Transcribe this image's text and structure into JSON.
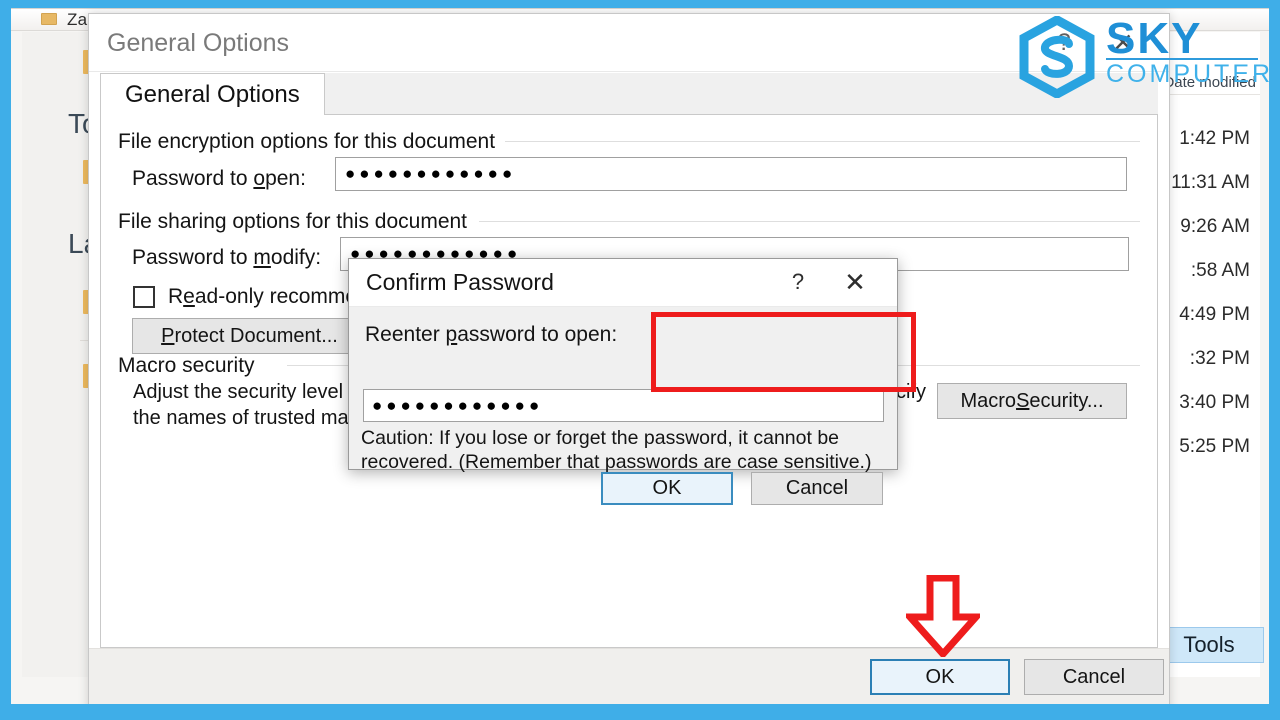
{
  "frame": {
    "accent_color": "#3FAEE8"
  },
  "explorer": {
    "window_title": "Zalo Received",
    "nav_items": [
      {
        "label": ""
      },
      {
        "label": "To"
      },
      {
        "label": ""
      },
      {
        "label": "La"
      },
      {
        "label": ""
      },
      {
        "label": ""
      }
    ],
    "column_header": "Date modified",
    "times": [
      "1:42 PM",
      "11:31 AM",
      "9:26 AM",
      ":58 AM",
      "4:49 PM",
      ":32 PM",
      "3:40 PM",
      "5:25 PM"
    ],
    "tools_button": "Tools"
  },
  "general_options": {
    "title": "General Options",
    "help_icon": "?",
    "close_icon": "✕",
    "tab_label": "General Options",
    "encryption_group": "File encryption options for this document",
    "password_open_label_pre": "Password to ",
    "password_open_label_key": "o",
    "password_open_label_post": "pen:",
    "password_open_value": "●●●●●●●●●●●●",
    "sharing_group": "File sharing options for this document",
    "password_modify_label_pre": "Password to ",
    "password_modify_label_key": "m",
    "password_modify_label_post": "odify:",
    "password_modify_value": "●●●●●●●●●●●●",
    "readonly_checkbox_label": "Read-only recommen",
    "readonly_checkbox_key": "e",
    "protect_document_button": "Protect Document...",
    "protect_document_key": "P",
    "macro_group": "Macro security",
    "macro_description_line1": "Adjust the security level",
    "macro_description_line2": "the names of trusted ma",
    "macro_description_tail": "cify",
    "macro_security_button_pre": "Macro ",
    "macro_security_button_key": "S",
    "macro_security_button_post": "ecurity...",
    "ok_button": "OK",
    "cancel_button": "Cancel"
  },
  "confirm_password": {
    "title": "Confirm Password",
    "help_icon": "?",
    "close_icon": "✕",
    "reenter_label_pre": "Reenter ",
    "reenter_label_key": "p",
    "reenter_label_post": "assword to open:",
    "password_value": "●●●●●●●●●●●●",
    "caution_text": "Caution: If you lose or forget the password, it cannot be recovered. (Remember that passwords are case sensitive.)",
    "ok_button": "OK",
    "cancel_button": "Cancel"
  },
  "annotations": {
    "highlight_color": "#EE1C1C",
    "arrow_color": "#EE1C1C",
    "arrow_direction": "down"
  },
  "watermark": {
    "brand": "SKY",
    "sub_brand": "COMPUTER",
    "color": "#1F8FD6"
  }
}
